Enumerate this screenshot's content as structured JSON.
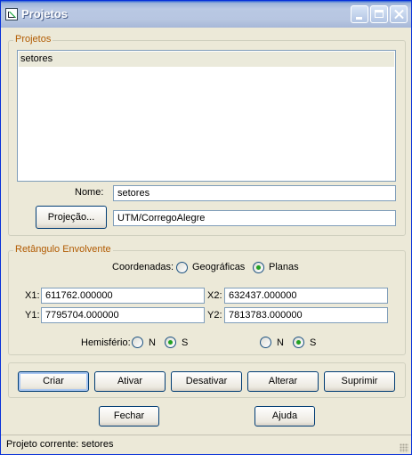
{
  "window": {
    "title": "Projetos"
  },
  "projects_group": {
    "legend": "Projetos",
    "list_items": [
      "setores"
    ],
    "name_label": "Nome:",
    "name_value": "setores",
    "projection_button": "Projeção...",
    "projection_value": "UTM/CorregoAlegre"
  },
  "bbox_group": {
    "legend": "Retângulo Envolvente",
    "coords_label": "Coordenadas:",
    "coord_options": [
      "Geográficas",
      "Planas"
    ],
    "coord_selected": "Planas",
    "x1_label": "X1:",
    "x1_value": "611762.000000",
    "x2_label": "X2:",
    "x2_value": "632437.000000",
    "y1_label": "Y1:",
    "y1_value": "7795704.000000",
    "y2_label": "Y2:",
    "y2_value": "7813783.000000",
    "hemisphere_label": "Hemisfério:",
    "hemisphere_left": {
      "options": [
        "N",
        "S"
      ],
      "selected": "S"
    },
    "hemisphere_right": {
      "options": [
        "N",
        "S"
      ],
      "selected": "S"
    }
  },
  "actions": {
    "create": "Criar",
    "activate": "Ativar",
    "deactivate": "Desativar",
    "alter": "Alterar",
    "delete": "Suprimir"
  },
  "footer_buttons": {
    "close": "Fechar",
    "help": "Ajuda"
  },
  "status": "Projeto corrente: setores"
}
